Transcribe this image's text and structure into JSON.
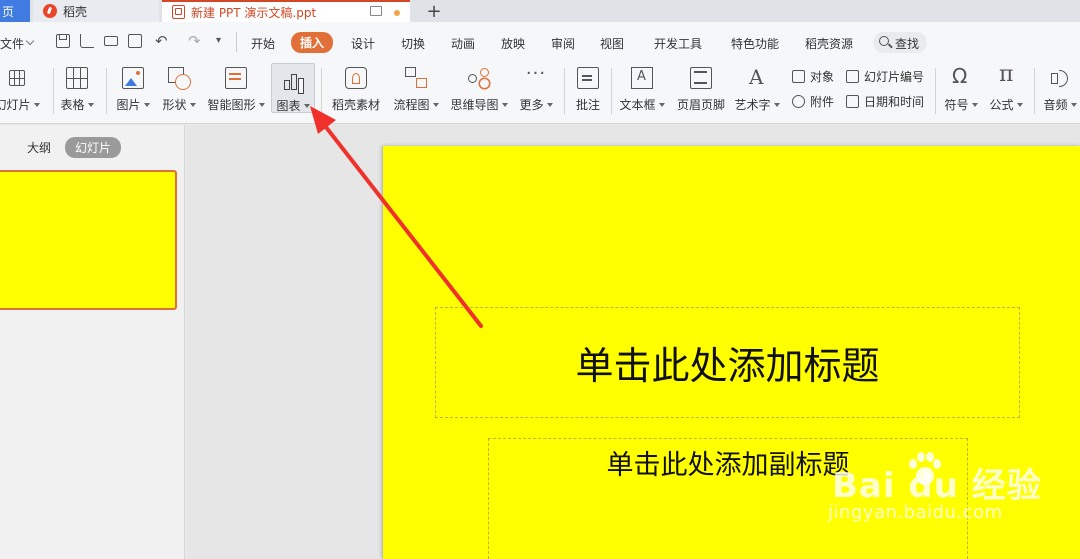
{
  "tabs": {
    "home": "页",
    "daoke": "稻壳",
    "document": "新建 PPT 演示文稿.ppt",
    "add": "+"
  },
  "menu": {
    "file": "文件",
    "items": [
      "开始",
      "插入",
      "设计",
      "切换",
      "动画",
      "放映",
      "审阅",
      "视图",
      "开发工具",
      "特色功能",
      "稻壳资源"
    ],
    "active": "插入",
    "search": "查找"
  },
  "ribbon": {
    "new_slide": "幻灯片",
    "table": "表格",
    "picture": "图片",
    "shape": "形状",
    "smart_art": "智能图形",
    "chart": "图表",
    "daoke_material": "稻壳素材",
    "flowchart": "流程图",
    "mindmap": "思维导图",
    "more": "更多",
    "comment": "批注",
    "textbox": "文本框",
    "header_footer": "页眉页脚",
    "word_art": "艺术字",
    "object": "对象",
    "attachment": "附件",
    "slide_number": "幻灯片编号",
    "date_time": "日期和时间",
    "symbol": "符号",
    "formula": "公式",
    "audio": "音频"
  },
  "left_panel": {
    "outline_tab": "大纲",
    "slides_tab": "幻灯片"
  },
  "slide": {
    "title_placeholder": "单击此处添加标题",
    "subtitle_placeholder": "单击此处添加副标题"
  },
  "watermark": {
    "brand": "Bai du 经验",
    "url": "jingyan.baidu.com"
  },
  "colors": {
    "accent": "#e07038",
    "slide_bg": "#ffff00",
    "arrow": "#f0302a"
  }
}
